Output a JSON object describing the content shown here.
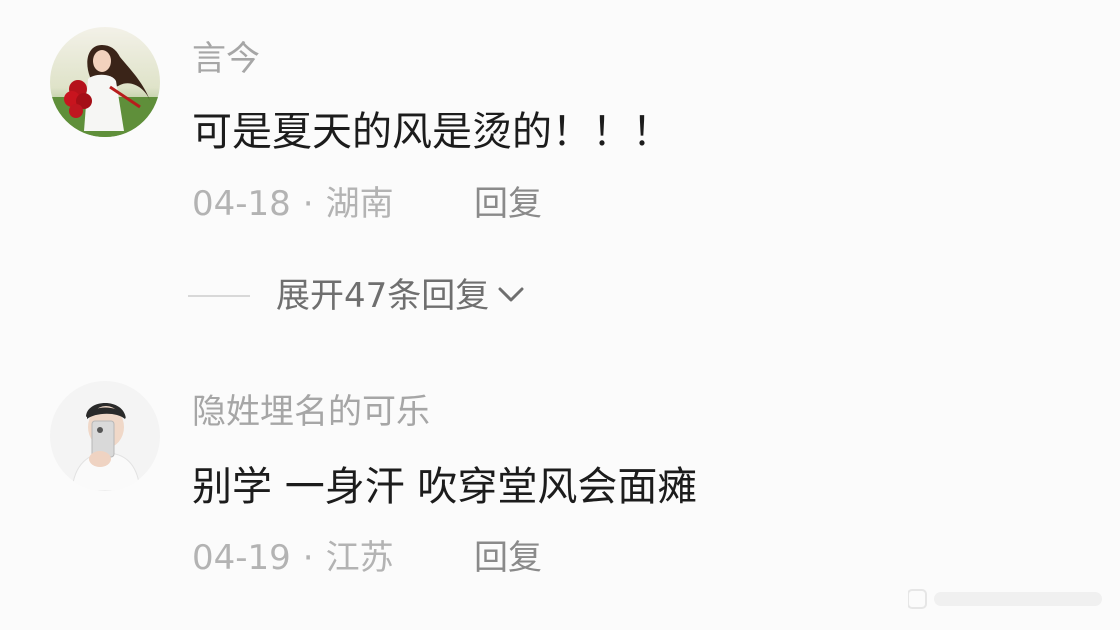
{
  "comments": [
    {
      "username": "言今",
      "text": "可是夏天的风是烫的！！！",
      "date": "04-18",
      "separator": "·",
      "location": "湖南",
      "reply_label": "回复"
    },
    {
      "username": "隐姓埋名的可乐",
      "text": "别学 一身汗 吹穿堂风会面瘫",
      "date": "04-19",
      "separator": "·",
      "location": "江苏",
      "reply_label": "回复"
    }
  ],
  "expand": {
    "label": "展开47条回复",
    "icon": "chevron-down-icon"
  },
  "colors": {
    "background": "#fbfbfb",
    "username": "#a6a6a6",
    "comment_text": "#1c1c1c",
    "meta": "#b3b3b3",
    "reply": "#8a8a8a",
    "expand": "#6f6f6f"
  }
}
